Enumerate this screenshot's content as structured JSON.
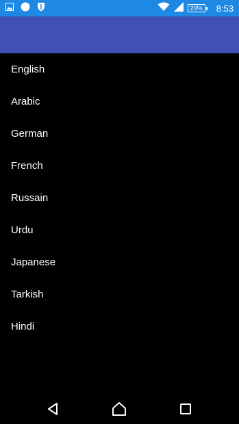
{
  "status_bar": {
    "time": "8:53",
    "battery_percent": "29%",
    "icons": [
      "image-icon",
      "circle-icon",
      "shield-icon",
      "wifi-icon",
      "signal-icon",
      "battery-icon"
    ]
  },
  "toolbar": {
    "color": "#3f51b5"
  },
  "languages": [
    {
      "label": "English"
    },
    {
      "label": "Arabic"
    },
    {
      "label": "German"
    },
    {
      "label": "French"
    },
    {
      "label": "Russain"
    },
    {
      "label": "Urdu"
    },
    {
      "label": "Japanese"
    },
    {
      "label": "Tarkish"
    },
    {
      "label": "Hindi"
    }
  ],
  "nav_bar": {
    "icons": [
      "back-icon",
      "home-icon",
      "recent-apps-icon"
    ]
  },
  "colors": {
    "status_bar": "#1e88e5",
    "toolbar": "#3f51b5",
    "background": "#000000",
    "text": "#ffffff"
  }
}
